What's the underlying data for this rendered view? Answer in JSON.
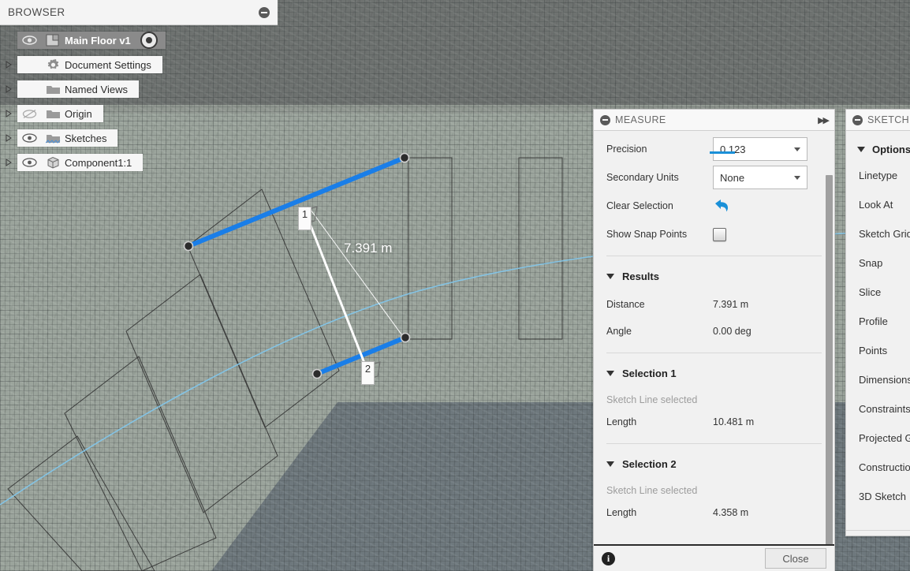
{
  "browser": {
    "title": "BROWSER",
    "collapse_icon": "collapse-minus-icon",
    "items": [
      {
        "label": "Main Floor v1",
        "icon": "component-icon",
        "eye": "eye-visible-icon",
        "selected": true,
        "has_arrow": false,
        "has_radio": true
      },
      {
        "label": "Document Settings",
        "icon": "gear-icon",
        "eye": "",
        "selected": false,
        "has_arrow": true,
        "has_radio": false
      },
      {
        "label": "Named Views",
        "icon": "folder-icon",
        "eye": "",
        "selected": false,
        "has_arrow": true,
        "has_radio": false
      },
      {
        "label": "Origin",
        "icon": "folder-icon",
        "eye": "eye-hidden-icon",
        "selected": false,
        "has_arrow": true,
        "has_radio": false
      },
      {
        "label": "Sketches",
        "icon": "folder-sketch-icon",
        "eye": "eye-visible-icon",
        "selected": false,
        "has_arrow": true,
        "has_radio": false
      },
      {
        "label": "Component1:1",
        "icon": "cube-icon",
        "eye": "eye-visible-icon",
        "selected": false,
        "has_arrow": true,
        "has_radio": false
      }
    ]
  },
  "measure": {
    "title": "MEASURE",
    "collapse_icon": "collapse-minus-icon",
    "pin_icon": "fast-forward-icon",
    "fields": {
      "precision_label": "Precision",
      "precision_value": "0.123",
      "secondary_units_label": "Secondary Units",
      "secondary_units_value": "None",
      "clear_selection_label": "Clear Selection",
      "clear_selection_icon": "undo-arrow-icon",
      "show_snap_points_label": "Show Snap Points",
      "show_snap_points_checked": false
    },
    "results": {
      "heading": "Results",
      "rows": [
        {
          "key": "Distance",
          "value": "7.391 m"
        },
        {
          "key": "Angle",
          "value": "0.00 deg"
        }
      ]
    },
    "selection1": {
      "heading": "Selection 1",
      "status": "Sketch Line selected",
      "rows": [
        {
          "key": "Length",
          "value": "10.481 m"
        }
      ]
    },
    "selection2": {
      "heading": "Selection 2",
      "status": "Sketch Line selected",
      "rows": [
        {
          "key": "Length",
          "value": "4.358 m"
        }
      ]
    },
    "footer": {
      "info_icon": "info-icon",
      "info_glyph": "i",
      "close_label": "Close"
    }
  },
  "sketch": {
    "title": "SKETCH",
    "collapse_icon": "collapse-minus-icon",
    "options_heading": "Options",
    "items": [
      "Linetype",
      "Look At",
      "Sketch Grid",
      "Snap",
      "Slice",
      "Profile",
      "Points",
      "Dimensions",
      "Constraints",
      "Projected Geometry",
      "Construction",
      "3D Sketch"
    ]
  },
  "canvas": {
    "dimension_label": "7.391 m",
    "marker1": "1",
    "marker2": "2",
    "selected_color": "#1a7ee8",
    "measure_line_color": "#ffffff",
    "curve_color": "#7fc2e8"
  }
}
